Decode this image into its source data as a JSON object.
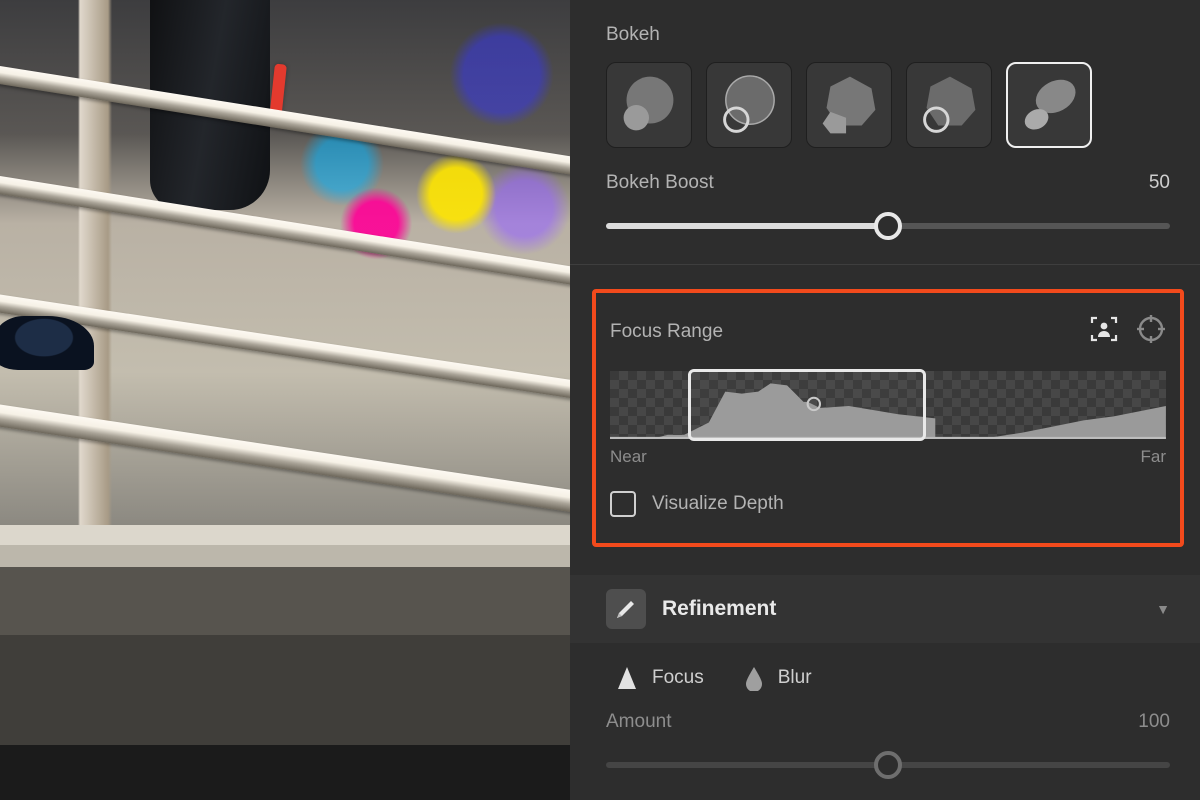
{
  "bokeh": {
    "label": "Bokeh",
    "selected_index": 4,
    "shapes": [
      "soft-circle",
      "ring-circle",
      "blade-soft",
      "blade-ring",
      "cat-eye"
    ]
  },
  "bokeh_boost": {
    "label": "Bokeh Boost",
    "value": 50,
    "min": 0,
    "max": 100
  },
  "focus_range": {
    "label": "Focus Range",
    "near_label": "Near",
    "far_label": "Far",
    "visualize_label": "Visualize Depth",
    "visualize_checked": false
  },
  "refinement": {
    "label": "Refinement",
    "focus_label": "Focus",
    "blur_label": "Blur"
  },
  "amount": {
    "label": "Amount",
    "value": 100
  }
}
